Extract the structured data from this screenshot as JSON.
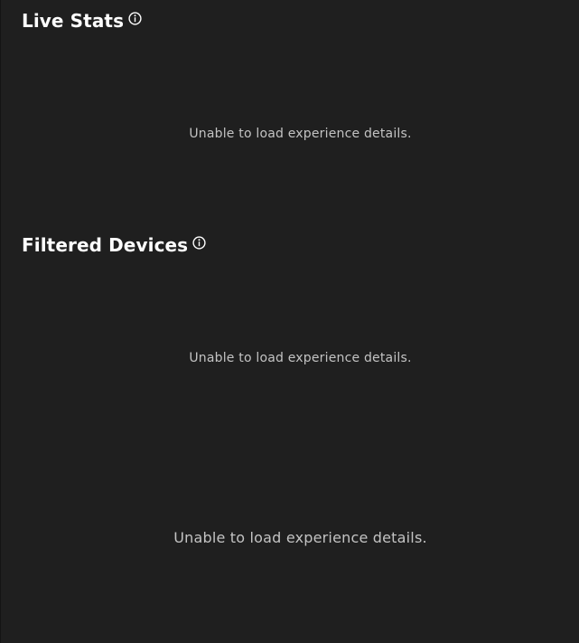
{
  "live_stats": {
    "title": "Live Stats",
    "info_icon": "info-circle-icon",
    "message": "Unable to load experience details."
  },
  "filtered_devices": {
    "title": "Filtered Devices",
    "info_icon": "info-circle-icon",
    "message": "Unable to load experience details."
  },
  "bottom_panel": {
    "message": "Unable to load experience details."
  },
  "colors": {
    "background": "#1f1f1f",
    "title": "#ffffff",
    "message": "#c3c3c3"
  }
}
